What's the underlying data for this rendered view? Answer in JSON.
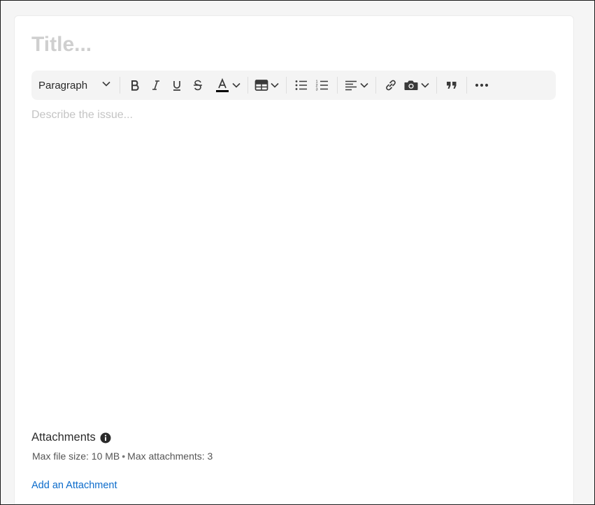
{
  "editor": {
    "title_placeholder": "Title...",
    "body_placeholder": "Describe the issue..."
  },
  "toolbar": {
    "format_select_value": "Paragraph",
    "text_color": "#000000",
    "tools": [
      "bold",
      "italic",
      "underline",
      "strikethrough",
      "text-color",
      "table",
      "bulleted-list",
      "numbered-list",
      "align",
      "link",
      "image",
      "blockquote",
      "more"
    ]
  },
  "attachments": {
    "label": "Attachments",
    "max_file_size": "Max file size: 10 MB",
    "separator": "•",
    "max_attachments": "Max attachments: 3",
    "add_link": "Add an Attachment"
  },
  "colors": {
    "link": "#0b6bcb",
    "toolbar_bg": "#f4f4f4",
    "page_bg": "#f5f5f5"
  }
}
